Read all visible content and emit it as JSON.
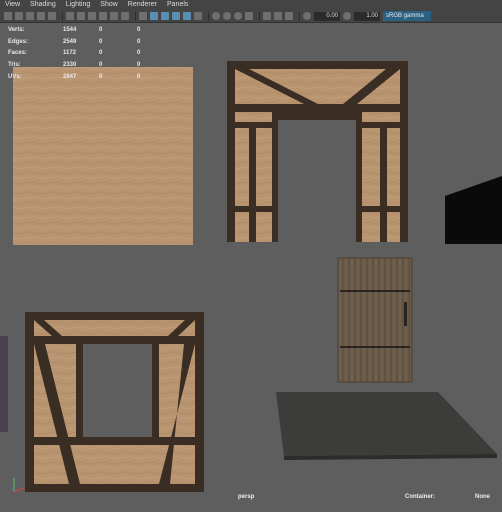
{
  "menu": [
    "View",
    "Shading",
    "Lighting",
    "Show",
    "Renderer",
    "Panels"
  ],
  "toolbar": {
    "exposure": "0.00",
    "gamma": "1.00",
    "color_space": "sRGB gamma"
  },
  "hud": {
    "rows": [
      {
        "label": "Verts:",
        "values": [
          "1544",
          "0",
          "0"
        ]
      },
      {
        "label": "Edges:",
        "values": [
          "2549",
          "0",
          "0"
        ]
      },
      {
        "label": "Faces:",
        "values": [
          "1172",
          "0",
          "0"
        ]
      },
      {
        "label": "Tris:",
        "values": [
          "2330",
          "0",
          "0"
        ]
      },
      {
        "label": "UVs:",
        "values": [
          "2847",
          "0",
          "0"
        ]
      }
    ]
  },
  "viewport": {
    "camera": "persp",
    "container_label": "Container:",
    "container_value": "None"
  },
  "colors": {
    "wood_dark": "#3a2e24",
    "plaster": "#b99471",
    "door_wood": "#6a5a48",
    "floor": "#3c3c3a",
    "viewport_bg": "#5e5e5e"
  }
}
